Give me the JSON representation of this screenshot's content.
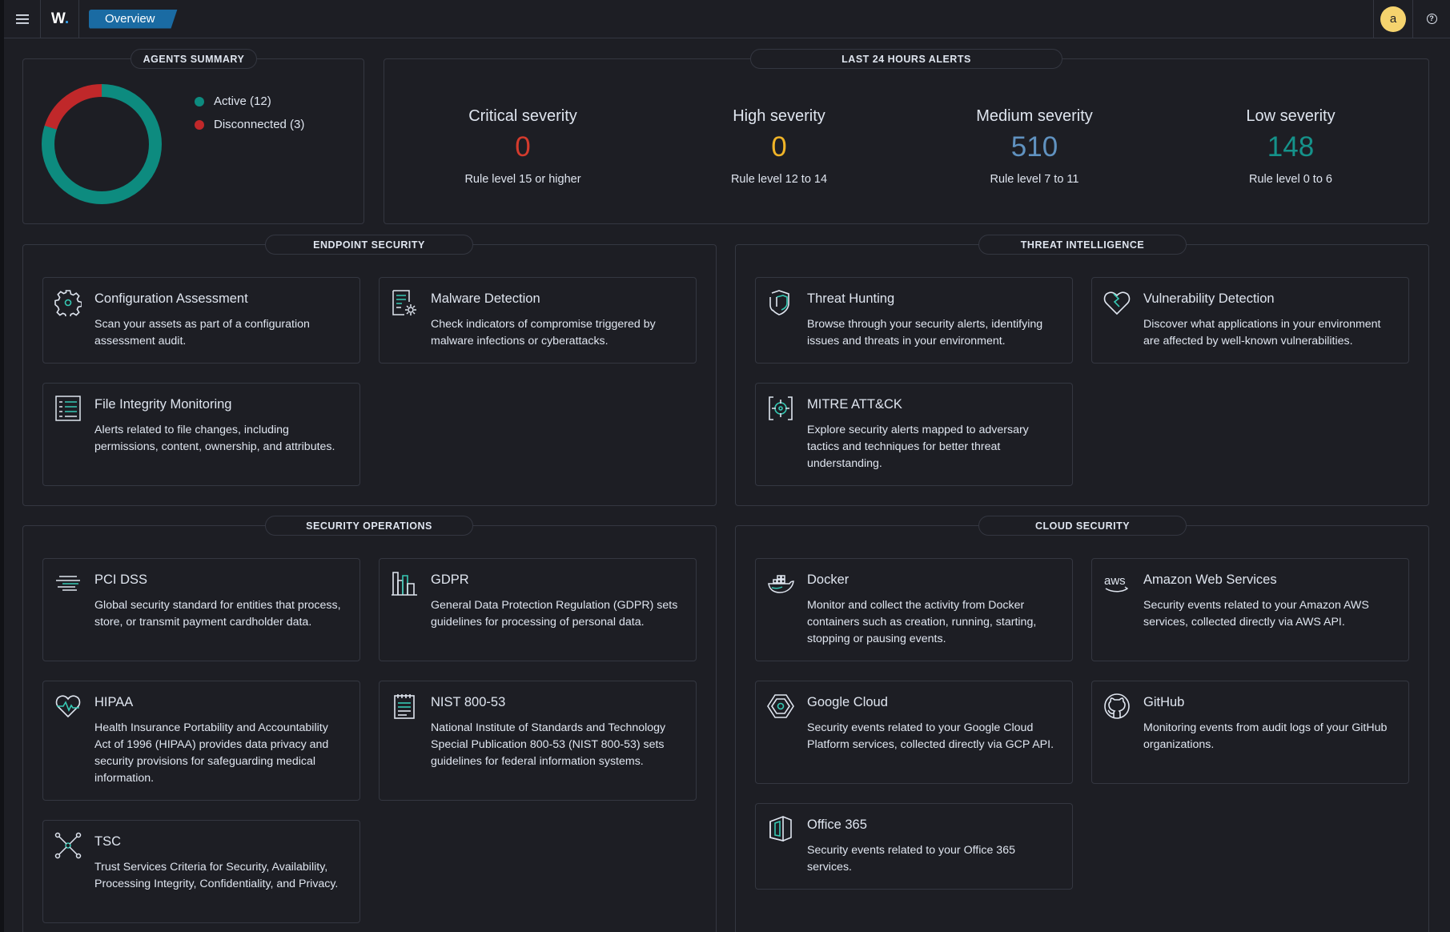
{
  "header": {
    "logo_text": "W",
    "logo_dot": ".",
    "breadcrumb": "Overview",
    "avatar_initial": "a",
    "help_glyph": "?"
  },
  "agents_summary": {
    "title": "AGENTS SUMMARY",
    "active_label": "Active (12)",
    "disconnected_label": "Disconnected (3)",
    "active_count": 12,
    "disconnected_count": 3,
    "active_color": "#0d8b7f",
    "disconnected_color": "#c0282a"
  },
  "alerts": {
    "title": "LAST 24 HOURS ALERTS",
    "items": [
      {
        "title": "Critical severity",
        "value": "0",
        "sub": "Rule level 15 or higher",
        "color": "#d43b2d"
      },
      {
        "title": "High severity",
        "value": "0",
        "sub": "Rule level 12 to 14",
        "color": "#f0b428"
      },
      {
        "title": "Medium severity",
        "value": "510",
        "sub": "Rule level 7 to 11",
        "color": "#6092c0"
      },
      {
        "title": "Low severity",
        "value": "148",
        "sub": "Rule level 0 to 6",
        "color": "#15928a"
      }
    ]
  },
  "sections": {
    "endpoint": {
      "title": "ENDPOINT SECURITY",
      "cards": [
        {
          "icon": "gear-icon",
          "title": "Configuration Assessment",
          "desc": "Scan your assets as part of a configuration assessment audit."
        },
        {
          "icon": "malware-document-icon",
          "title": "Malware Detection",
          "desc": "Check indicators of compromise triggered by malware infections or cyberattacks."
        },
        {
          "icon": "file-list-icon",
          "title": "File Integrity Monitoring",
          "desc": "Alerts related to file changes, including permissions, content, ownership, and attributes."
        }
      ]
    },
    "threat": {
      "title": "THREAT INTELLIGENCE",
      "cards": [
        {
          "icon": "shield-hunting-icon",
          "title": "Threat Hunting",
          "desc": "Browse through your security alerts, identifying issues and threats in your environment."
        },
        {
          "icon": "broken-heart-icon",
          "title": "Vulnerability Detection",
          "desc": "Discover what applications in your environment are affected by well-known vulnerabilities."
        },
        {
          "icon": "crosshair-icon",
          "title": "MITRE ATT&CK",
          "desc": "Explore security alerts mapped to adversary tactics and techniques for better threat understanding."
        }
      ]
    },
    "secops": {
      "title": "SECURITY OPERATIONS",
      "cards": [
        {
          "icon": "pci-lines-icon",
          "title": "PCI DSS",
          "desc": "Global security standard for entities that process, store, or transmit payment cardholder data."
        },
        {
          "icon": "gdpr-bars-icon",
          "title": "GDPR",
          "desc": "General Data Protection Regulation (GDPR) sets guidelines for processing of personal data."
        },
        {
          "icon": "heart-pulse-icon",
          "title": "HIPAA",
          "desc": "Health Insurance Portability and Accountability Act of 1996 (HIPAA) provides data privacy and security provisions for safeguarding medical information."
        },
        {
          "icon": "notepad-icon",
          "title": "NIST 800-53",
          "desc": "National Institute of Standards and Technology Special Publication 800-53 (NIST 800-53) sets guidelines for federal information systems."
        },
        {
          "icon": "network-nodes-icon",
          "title": "TSC",
          "desc": "Trust Services Criteria for Security, Availability, Processing Integrity, Confidentiality, and Privacy."
        }
      ]
    },
    "cloud": {
      "title": "CLOUD SECURITY",
      "cards": [
        {
          "icon": "docker-icon",
          "title": "Docker",
          "desc": "Monitor and collect the activity from Docker containers such as creation, running, starting, stopping or pausing events."
        },
        {
          "icon": "aws-logo-icon",
          "title": "Amazon Web Services",
          "desc": "Security events related to your Amazon AWS services, collected directly via AWS API.",
          "logo_text": "aws"
        },
        {
          "icon": "google-cloud-icon",
          "title": "Google Cloud",
          "desc": "Security events related to your Google Cloud Platform services, collected directly via GCP API."
        },
        {
          "icon": "github-icon",
          "title": "GitHub",
          "desc": "Monitoring events from audit logs of your GitHub organizations."
        },
        {
          "icon": "office365-icon",
          "title": "Office 365",
          "desc": "Security events related to your Office 365 services."
        }
      ]
    }
  }
}
